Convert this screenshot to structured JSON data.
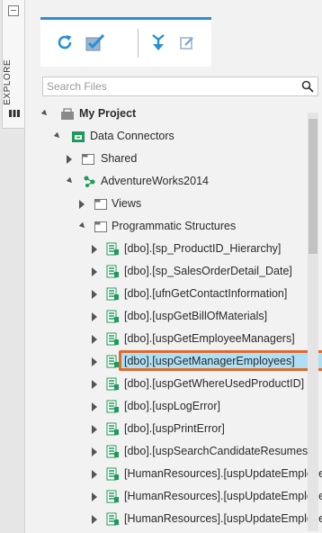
{
  "side_tab": {
    "label": "EXPLORE"
  },
  "toolbar": {
    "refresh_title": "Refresh",
    "check_title": "Check",
    "move_title": "Move",
    "edit_title": "Edit"
  },
  "search": {
    "placeholder": "Search Files",
    "value": ""
  },
  "tree": {
    "project": "My Project",
    "data_connectors": "Data Connectors",
    "shared": "Shared",
    "connector": "AdventureWorks2014",
    "views": "Views",
    "programmatic": "Programmatic Structures",
    "procedures": [
      "[dbo].[sp_ProductID_Hierarchy]",
      "[dbo].[sp_SalesOrderDetail_Date]",
      "[dbo].[ufnGetContactInformation]",
      "[dbo].[uspGetBillOfMaterials]",
      "[dbo].[uspGetEmployeeManagers]",
      "[dbo].[uspGetManagerEmployees]",
      "[dbo].[uspGetWhereUsedProductID]",
      "[dbo].[uspLogError]",
      "[dbo].[uspPrintError]",
      "[dbo].[uspSearchCandidateResumes]",
      "[HumanResources].[uspUpdateEmploye",
      "[HumanResources].[uspUpdateEmploye",
      "[HumanResources].[uspUpdateEmploye"
    ],
    "selected_index": 5
  },
  "colors": {
    "accent": "#2a8fd4",
    "highlight": "#e06a2e",
    "selection": "#aedff5",
    "folder_green": "#1e9a5a"
  }
}
